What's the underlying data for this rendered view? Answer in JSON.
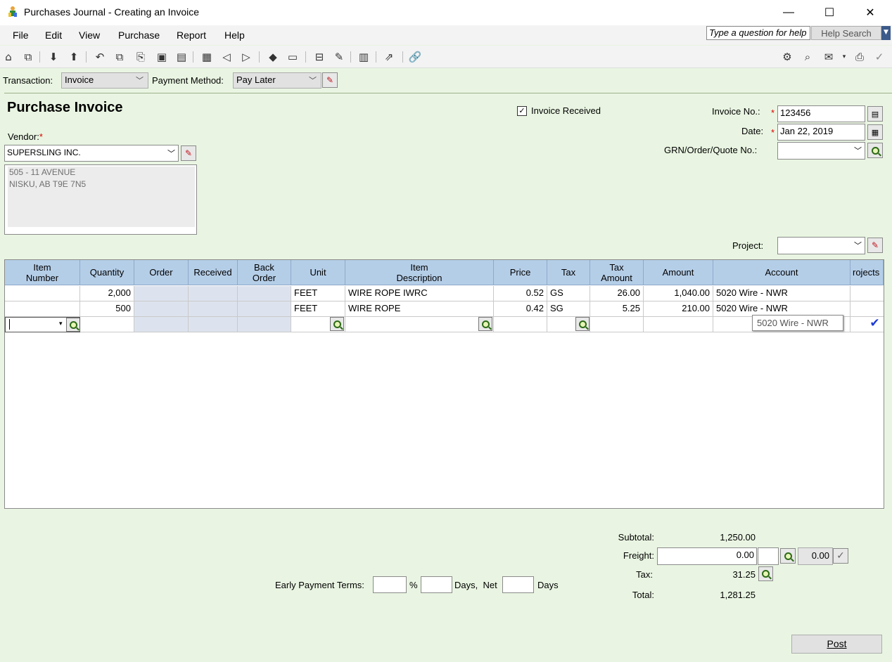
{
  "window": {
    "title": "Purchases Journal - Creating an Invoice",
    "minimize": "—",
    "maximize": "☐",
    "close": "✕"
  },
  "menu": {
    "items": [
      "File",
      "Edit",
      "View",
      "Purchase",
      "Report",
      "Help"
    ]
  },
  "help": {
    "question_placeholder": "Type a question for help",
    "search_label": "Help Search"
  },
  "transaction": {
    "label": "Transaction:",
    "value": "Invoice",
    "payment_label": "Payment Method:",
    "payment_value": "Pay Later"
  },
  "form": {
    "title": "Purchase Invoice",
    "invoice_received_label": "Invoice Received",
    "invoice_received": true,
    "invoice_no_label": "Invoice No.:",
    "invoice_no": "123456",
    "date_label": "Date:",
    "date": "Jan 22, 2019",
    "grn_label": "GRN/Order/Quote No.:",
    "grn_value": "",
    "vendor_label": "Vendor:",
    "vendor": "SUPERSLING INC.",
    "address_line1": "505 - 11 AVENUE",
    "address_line2": "NISKU, AB  T9E 7N5",
    "project_label": "Project:",
    "required_mark": "*"
  },
  "grid": {
    "headers": [
      {
        "line1": "Item",
        "line2": "Number"
      },
      {
        "line1": "Quantity",
        "line2": ""
      },
      {
        "line1": "Order",
        "line2": ""
      },
      {
        "line1": "Received",
        "line2": ""
      },
      {
        "line1": "Back",
        "line2": "Order"
      },
      {
        "line1": "Unit",
        "line2": ""
      },
      {
        "line1": "Item",
        "line2": "Description"
      },
      {
        "line1": "Price",
        "line2": ""
      },
      {
        "line1": "Tax",
        "line2": ""
      },
      {
        "line1": "Tax",
        "line2": "Amount"
      },
      {
        "line1": "Amount",
        "line2": ""
      },
      {
        "line1": "Account",
        "line2": ""
      },
      {
        "line1": "rojects",
        "line2": ""
      }
    ],
    "rows": [
      {
        "item": "",
        "quantity": "2,000",
        "order": "",
        "received": "",
        "back_order": "",
        "unit": "FEET",
        "description": "WIRE ROPE IWRC",
        "price": "0.52",
        "tax": "GS",
        "tax_amount": "26.00",
        "amount": "1,040.00",
        "account": "5020 Wire  - NWR",
        "projects": ""
      },
      {
        "item": "",
        "quantity": "500",
        "order": "",
        "received": "",
        "back_order": "",
        "unit": "FEET",
        "description": "WIRE ROPE",
        "price": "0.42",
        "tax": "SG",
        "tax_amount": "5.25",
        "amount": "210.00",
        "account": "5020 Wire  - NWR",
        "projects": ""
      }
    ],
    "tooltip": "5020 Wire  - NWR"
  },
  "totals": {
    "subtotal_label": "Subtotal:",
    "subtotal": "1,250.00",
    "freight_label": "Freight:",
    "freight": "0.00",
    "freight_tax": "0.00",
    "tax_label": "Tax:",
    "tax": "31.25",
    "total_label": "Total:",
    "total": "1,281.25"
  },
  "terms": {
    "label": "Early Payment Terms:",
    "percent": "%",
    "days_net": "Days,  Net",
    "days": "Days"
  },
  "actions": {
    "post_label": "Post"
  }
}
